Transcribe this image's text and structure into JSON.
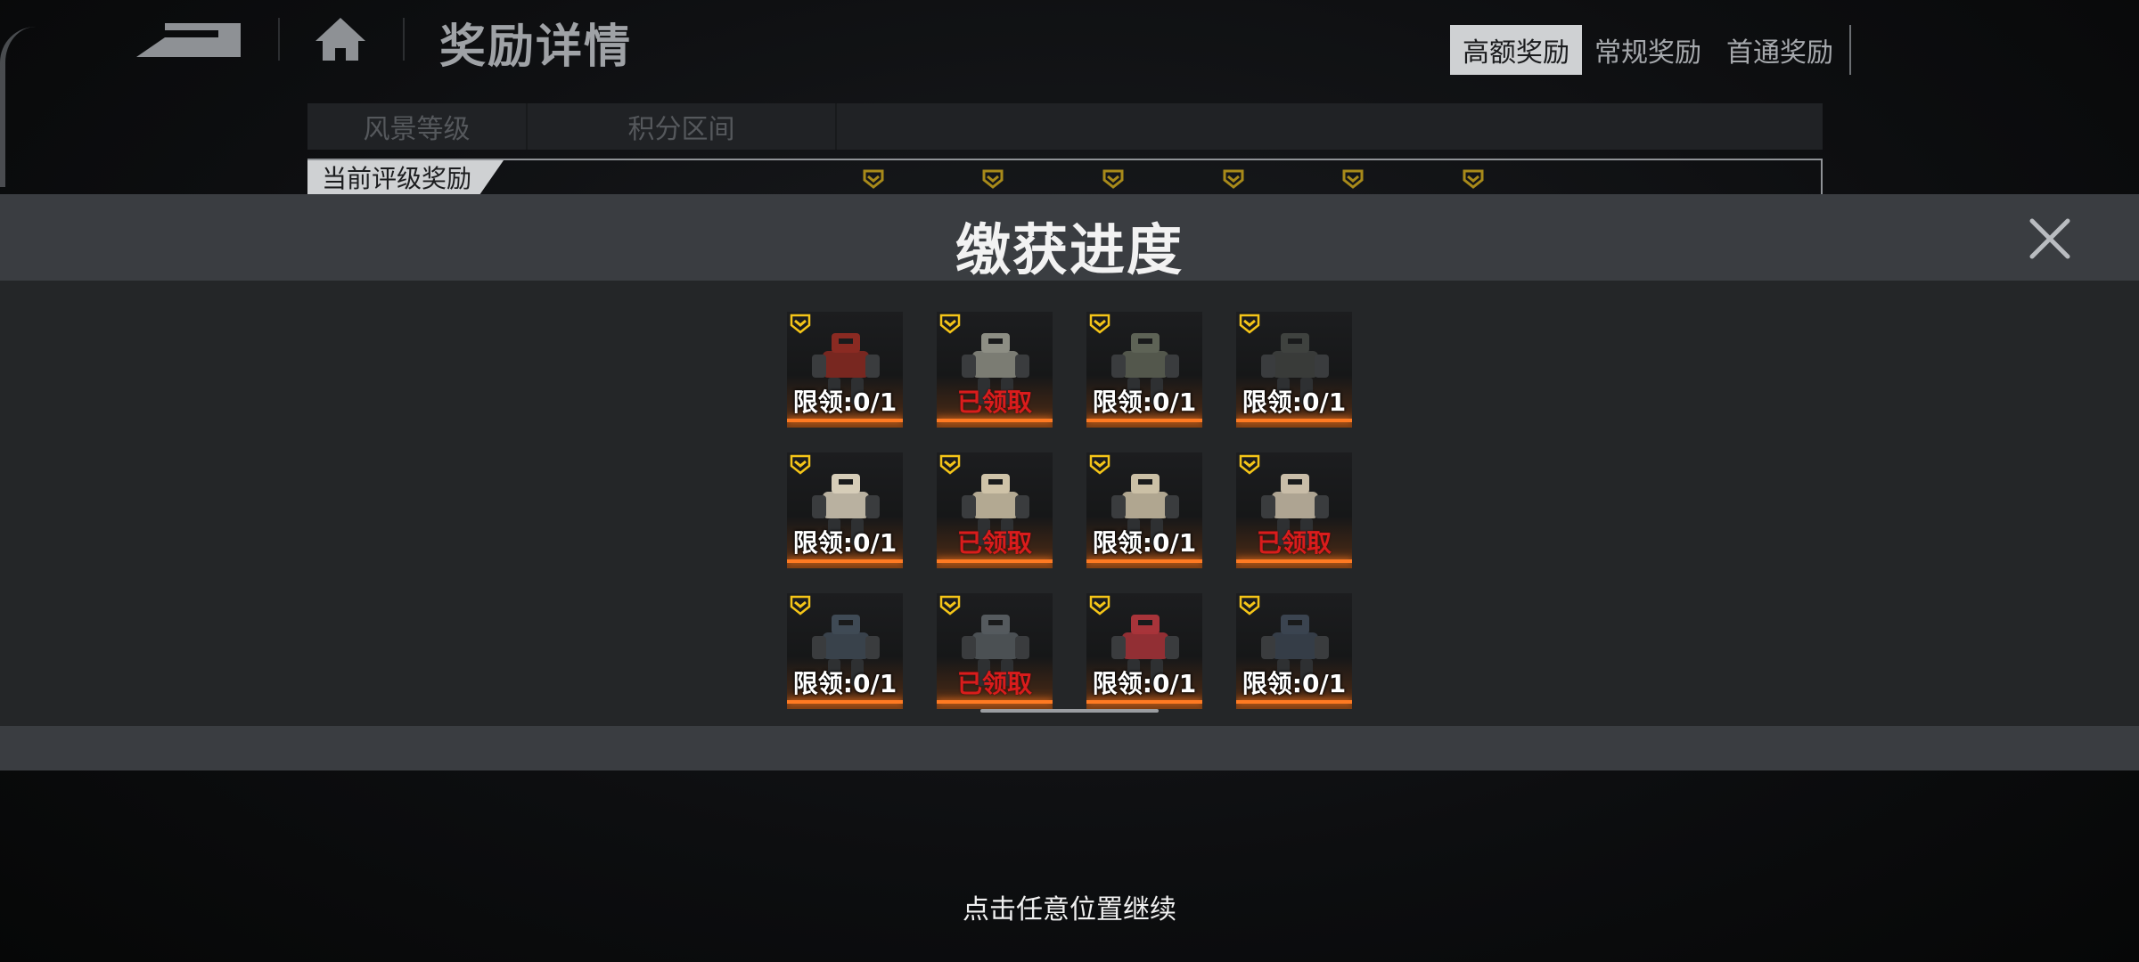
{
  "header": {
    "title": "奖励详情",
    "tabs": [
      {
        "label": "高额奖励",
        "active": true
      },
      {
        "label": "常规奖励",
        "active": false
      },
      {
        "label": "首通奖励",
        "active": false
      }
    ]
  },
  "table": {
    "columns": [
      "风景等级",
      "积分区间"
    ],
    "rating_label": "当前评级奖励"
  },
  "modal": {
    "title": "缴获进度",
    "items": [
      {
        "label": "限领:0/1",
        "claimed": false,
        "color": "#8a2a22"
      },
      {
        "label": "已领取",
        "claimed": true,
        "color": "#8d8e84"
      },
      {
        "label": "限领:0/1",
        "claimed": false,
        "color": "#5e6356"
      },
      {
        "label": "限领:0/1",
        "claimed": false,
        "color": "#3f423f"
      },
      {
        "label": "限领:0/1",
        "claimed": false,
        "color": "#d6cdb8"
      },
      {
        "label": "已领取",
        "claimed": true,
        "color": "#cfc3a8"
      },
      {
        "label": "限领:0/1",
        "claimed": false,
        "color": "#cbc0a6"
      },
      {
        "label": "已领取",
        "claimed": true,
        "color": "#c9bda8"
      },
      {
        "label": "限领:0/1",
        "claimed": false,
        "color": "#3f4a55"
      },
      {
        "label": "已领取",
        "claimed": true,
        "color": "#555a5e"
      },
      {
        "label": "限领:0/1",
        "claimed": false,
        "color": "#a8343a"
      },
      {
        "label": "限领:0/1",
        "claimed": false,
        "color": "#3b4450"
      }
    ]
  },
  "footer": {
    "hint": "点击任意位置继续"
  },
  "colors": {
    "accent_orange": "#ff7a22",
    "claimed_red": "#d91c1c",
    "rank_gold": "#f5c518"
  }
}
